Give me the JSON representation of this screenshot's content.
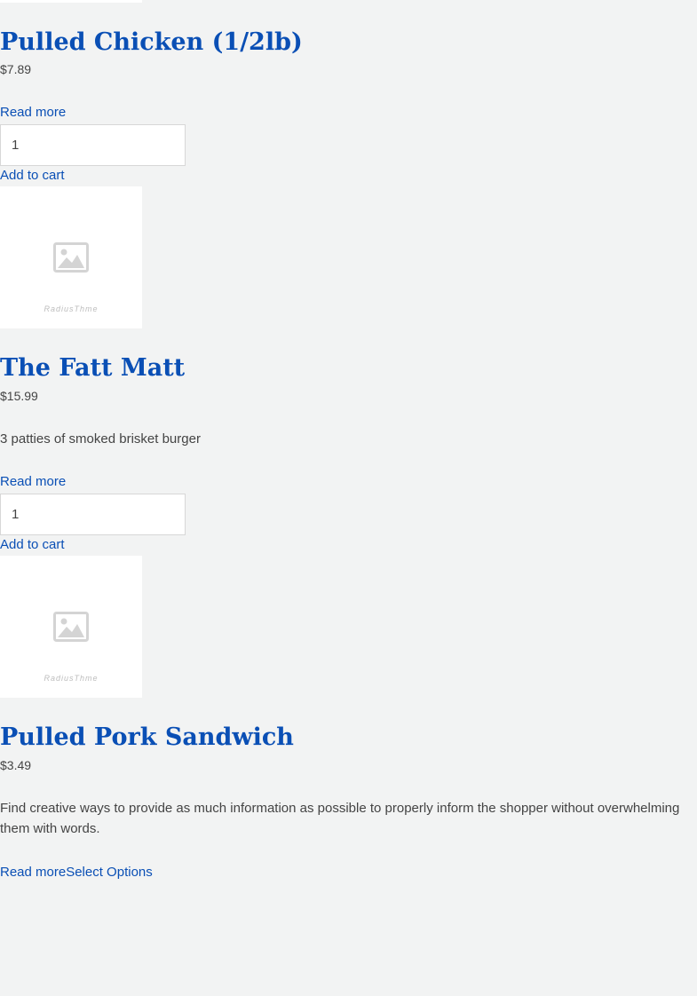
{
  "placeholder_brand": "RadiusThme",
  "products": [
    {
      "title": "Pulled Chicken (1/2lb)",
      "price": "$7.89",
      "read_more": "Read more",
      "quantity": "1",
      "add_to_cart": "Add to cart"
    },
    {
      "title": "The Fatt Matt",
      "price": "$15.99",
      "description": "3 patties of smoked brisket burger",
      "read_more": "Read more",
      "quantity": "1",
      "add_to_cart": "Add to cart"
    },
    {
      "title": "Pulled Pork Sandwich",
      "price": "$3.49",
      "description": "Find creative ways to provide as much information as possible to properly inform the shopper without overwhelming them with words.",
      "read_more": "Read more",
      "select_options": "Select Options"
    }
  ],
  "colors": {
    "page_background": "#f2f3f3",
    "link": "#0a4fb5",
    "text": "#444444",
    "placeholder_icon": "#d4d4d4"
  }
}
